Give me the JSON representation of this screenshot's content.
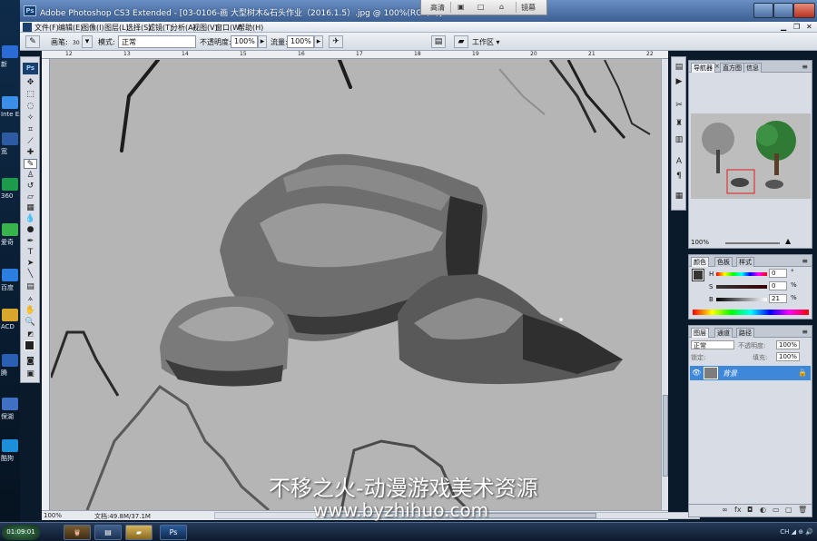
{
  "desktop": {
    "labels": [
      "新",
      "Inte Expl",
      "宽",
      "360",
      "爱奇",
      "百度",
      "ACD",
      "腾",
      "保湖",
      "酷狗"
    ]
  },
  "titlebar": {
    "title": "Adobe Photoshop CS3 Extended - [03-0106-画 大型树木&石头作业（2016.1.5）.jpg @ 100%(RGB/8)]"
  },
  "floatbar": {
    "items": [
      "高清",
      "▣",
      "□",
      "⌂",
      "镜幕"
    ]
  },
  "menu": {
    "items": [
      "文件(F)",
      "编辑(E)",
      "图像(I)",
      "图层(L)",
      "选择(S)",
      "滤镜(T)",
      "分析(A)",
      "视图(V)",
      "窗口(W)",
      "帮助(H)"
    ]
  },
  "options": {
    "brush_label": "画笔:",
    "brush_size": "30",
    "mode_label": "模式:",
    "mode_value": "正常",
    "opacity_label": "不透明度:",
    "opacity_value": "100%",
    "flow_label": "流量:",
    "flow_value": "100%",
    "workspace_label": "工作区 ▾"
  },
  "ruler": {
    "h_ticks": [
      "12",
      "13",
      "14",
      "15",
      "16",
      "17",
      "18",
      "19",
      "20",
      "21",
      "22"
    ]
  },
  "status": {
    "zoom": "100%",
    "doc_info": "文档:49.8M/37.1M"
  },
  "navigator": {
    "tabs": [
      "导航器",
      "直方图",
      "信息"
    ],
    "zoom": "100%"
  },
  "color_panel": {
    "tabs": [
      "颜色",
      "色板",
      "样式"
    ],
    "h_value": "0",
    "s_value": "0",
    "b_value": "21",
    "h_unit": "°",
    "s_unit": "%",
    "b_unit": "%",
    "h_label": "H",
    "s_label": "S",
    "b_label": "B"
  },
  "layers_panel": {
    "tabs": [
      "图层",
      "通道",
      "路径"
    ],
    "blend_mode": "正常",
    "opacity_label": "不透明度:",
    "opacity_value": "100%",
    "lock_label": "锁定:",
    "fill_label": "填充:",
    "fill_value": "100%",
    "layer_name": "背景"
  },
  "taskbar": {
    "time": "01:09:01",
    "tray": "CH ◢ ⊕ 🔊"
  },
  "watermark": {
    "line1": "不移之火-动漫游戏美术资源",
    "line2": "www.byzhihuo.com"
  },
  "colors": {
    "canvas_bg": "#b5b5b5",
    "selected_layer": "#3f87d8",
    "ps_blue": "#1b3f6d"
  }
}
